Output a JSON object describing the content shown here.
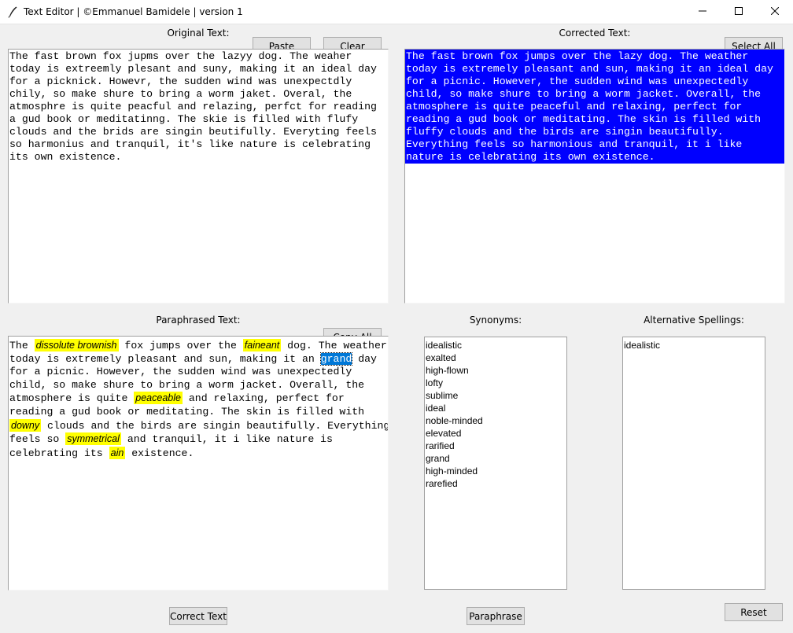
{
  "window": {
    "title": "Text Editor | ©Emmanuel Bamidele | version 1"
  },
  "original": {
    "label": "Original Text:",
    "paste_label": "Paste",
    "clear_label": "Clear",
    "text": "The fast brown fox jupms over the lazyy dog. The weaher\ntoday is extreemly plesant and suny, making it an ideal day\nfor a picknick. Howevr, the sudden wind was unexpectdly\nchily, so make shure to bring a worm jaket. Overal, the\natmosphre is quite peacful and relazing, perfct for reading\na gud book or meditatinng. The skie is filled with flufy\nclouds and the brids are singin beutifully. Everyting feels\nso harmonius and tranquil, it's like nature is celebrating\nits own existence."
  },
  "corrected": {
    "label": "Corrected Text:",
    "select_all_label": "Select All",
    "text": "The fast brown fox jumps over the lazy dog. The weather\ntoday is extremely pleasant and sun, making it an ideal day\nfor a picnic. However, the sudden wind was unexpectedly\nchild, so make shure to bring a worm jacket. Overall, the\natmosphere is quite peaceful and relaxing, perfect for\nreading a gud book or meditating. The skin is filled with\nfluffy clouds and the birds are singin beautifully.\nEverything feels so harmonious and tranquil, it i like\nnature is celebrating its own existence."
  },
  "paraphrased": {
    "label": "Paraphrased Text:",
    "copy_all_label": "Copy All",
    "line1": {
      "a": "The ",
      "h1": "dissolute brownish",
      "b": " fox jumps over the ",
      "h2": "faineant",
      "c": " dog. The weather"
    },
    "line2": {
      "a": "today is extremely pleasant and sun, making it an ",
      "sel": "grand",
      "b": " day"
    },
    "line3": "for a picnic. However, the sudden wind was unexpectedly",
    "line4": "child, so make shure to bring a worm jacket. Overall, the",
    "line5": {
      "a": "atmosphere is quite ",
      "h": "peaceable",
      "b": " and relaxing, perfect for"
    },
    "line6": "reading a gud book or meditating. The skin is filled with",
    "line7": {
      "h": "downy",
      "a": " clouds and the birds are singin beautifully. Everything"
    },
    "line8": {
      "a": "feels so ",
      "h": "symmetrical",
      "b": " and tranquil, it i like nature is"
    },
    "line9": {
      "a": "celebrating its ",
      "h": "ain",
      "b": " existence."
    }
  },
  "synonyms": {
    "label": "Synonyms:",
    "items": [
      "idealistic",
      "exalted",
      "high-flown",
      "lofty",
      "sublime",
      "ideal",
      "noble-minded",
      "elevated",
      "rarified",
      "grand",
      "high-minded",
      "rarefied"
    ]
  },
  "alternative_spellings": {
    "label": "Alternative Spellings:",
    "items": [
      "idealistic"
    ]
  },
  "actions": {
    "correct_label": "Correct Text",
    "paraphrase_label": "Paraphrase",
    "reset_label": "Reset"
  },
  "colors": {
    "selection": "#0000ff",
    "highlight": "#ffff00",
    "word_selection": "#0078d7"
  },
  "icons": {
    "app": "feather-pen-icon",
    "minimize": "minimize-icon",
    "maximize": "maximize-icon",
    "close": "close-icon"
  }
}
